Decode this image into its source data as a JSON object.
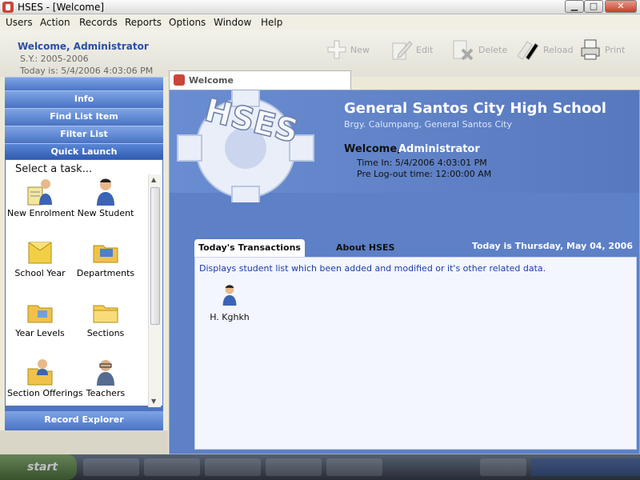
{
  "window": {
    "title": "HSES - [Welcome]",
    "min": "▁",
    "max": "□",
    "close": "✕"
  },
  "menu": [
    "Users",
    "Action",
    "Records",
    "Reports",
    "Options",
    "Window",
    "Help"
  ],
  "header": {
    "welcome": "Welcome, Administrator",
    "school_year": "S.Y.: 2005-2006",
    "today": "Today is: 5/4/2006 4:03:06 PM"
  },
  "toolbar": {
    "new": "New",
    "edit": "Edit",
    "delete": "Delete",
    "reload": "Reload",
    "print": "Print"
  },
  "left_panel": {
    "sections": [
      "Info",
      "Find List Item",
      "Filter List",
      "Quick Launch"
    ],
    "task_title": "Select a task...",
    "tasks": [
      "New Enrolment",
      "New Student",
      "School Year",
      "Departments",
      "Year Levels",
      "Sections",
      "Section Offerings",
      "Teachers"
    ],
    "footer": "Record Explorer"
  },
  "tab": {
    "label": "Welcome"
  },
  "main": {
    "logo_text": "HSES",
    "school_name": "General Santos City High School",
    "address": "Brgy. Calumpang, General Santos City",
    "welcome_prefix": "Welcome,",
    "welcome_user": "Administrator",
    "time_in": "Time In: 5/4/2006 4:03:01 PM",
    "pre_logout": "Pre Log-out time: 12:00:00 AM",
    "tabs": [
      "Today's Transactions",
      "About HSES"
    ],
    "today": "Today is Thursday, May 04, 2006",
    "description": "Displays student list which been added and modified or it's other related data.",
    "students": [
      "H. Kghkh"
    ]
  },
  "taskbar": {
    "start": "start"
  },
  "colors": {
    "accent": "#2b4ea4",
    "panel": "#5d80c6",
    "tab_icon": "#c8463a"
  }
}
